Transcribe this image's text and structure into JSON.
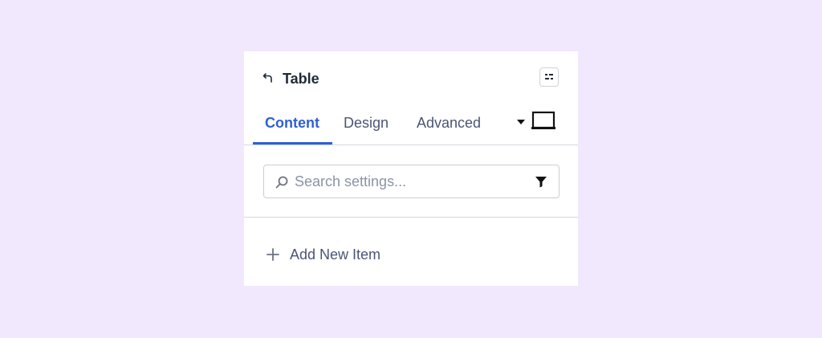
{
  "panel": {
    "title": "Table",
    "back_icon": "undo-arrow-icon",
    "menu_icon": "sliders-icon"
  },
  "tabs": [
    {
      "label": "Content",
      "active": true
    },
    {
      "label": "Design",
      "active": false
    },
    {
      "label": "Advanced",
      "active": false
    }
  ],
  "device": {
    "caret_icon": "caret-down-icon",
    "icon": "laptop-icon"
  },
  "search": {
    "placeholder": "Search settings...",
    "value": "",
    "filter_icon": "filter-icon"
  },
  "add_item": {
    "label": "Add New Item",
    "icon": "plus-icon"
  },
  "colors": {
    "background": "#f1e8fd",
    "accent": "#2f5fd8",
    "text": "#4b5576"
  }
}
